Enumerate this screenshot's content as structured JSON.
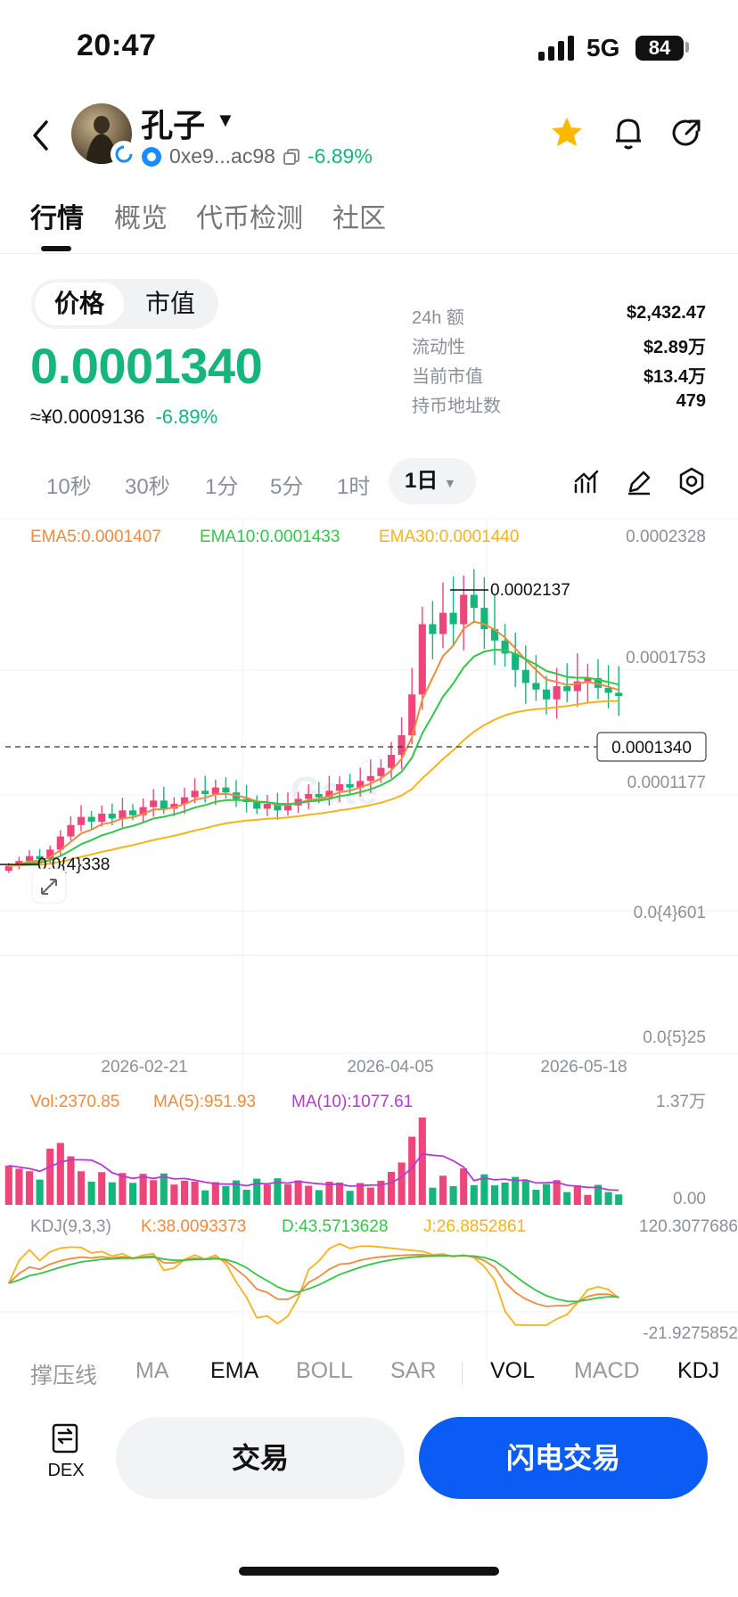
{
  "status": {
    "time": "20:47",
    "network": "5G",
    "battery": "84"
  },
  "token": {
    "name": "孔子",
    "address": "0xe9...ac98",
    "change": "-6.89%"
  },
  "tabs": [
    "行情",
    "概览",
    "代币检测",
    "社区"
  ],
  "price_toggle": [
    "价格",
    "市值"
  ],
  "price": {
    "main": "0.0001340",
    "cny": "≈¥0.0009136",
    "change": "-6.89%"
  },
  "stats": [
    {
      "label": "24h  额",
      "value": "$2,432.47"
    },
    {
      "label": "流动性",
      "value": "$2.89万"
    },
    {
      "label": "当前市值",
      "value": "$13.4万"
    },
    {
      "label": "持币地址数",
      "value": "479"
    }
  ],
  "intervals": [
    "10秒",
    "30秒",
    "1分",
    "5分",
    "1时"
  ],
  "selected_interval": "1日",
  "indicators": [
    "撑压线",
    "MA",
    "EMA",
    "BOLL",
    "SAR",
    "VOL",
    "MACD",
    "KDJ"
  ],
  "colors": {
    "up": "#f0457a",
    "down": "#16b57c",
    "ema5": "#f08a3c",
    "ema10": "#33c64a",
    "ema30": "#f5b31c",
    "brand": "#0a5cf5"
  },
  "chart_data": {
    "type": "candlestick",
    "price_panel": {
      "legend": {
        "ema5": "EMA5:0.0001407",
        "ema10": "EMA10:0.0001433",
        "ema30": "EMA30:0.0001440"
      },
      "y_ticks": [
        "0.0002328",
        "0.0001753",
        "0.0001177",
        "0.0{4}601",
        "0.0{5}25"
      ],
      "high_label": "0.0002137",
      "low_label": "0.0{4}338",
      "current_label": "0.0001340",
      "x_ticks": [
        "2026-02-21",
        "2026-04-05",
        "2026-05-18"
      ],
      "close_series": [
        3e-05,
        3.3e-05,
        3.6e-05,
        3.4e-05,
        4e-05,
        4.8e-05,
        5.5e-05,
        6e-05,
        5.7e-05,
        6.2e-05,
        5.9e-05,
        6.4e-05,
        6.1e-05,
        6.6e-05,
        7e-05,
        6.5e-05,
        6.8e-05,
        7.2e-05,
        7.6e-05,
        7.4e-05,
        7.8e-05,
        7.5e-05,
        7.1e-05,
        6.9e-05,
        6.5e-05,
        6.8e-05,
        6.4e-05,
        6.7e-05,
        7.1e-05,
        7.4e-05,
        7.2e-05,
        7.6e-05,
        8e-05,
        7.8e-05,
        8.2e-05,
        8.5e-05,
        9e-05,
        9.8e-05,
        0.00011,
        0.000135,
        0.000178,
        0.000172,
        0.000185,
        0.000178,
        0.000196,
        0.000188,
        0.000175,
        0.000168,
        0.00016,
        0.00015,
        0.000142,
        0.000138,
        0.000132,
        0.00014,
        0.000137,
        0.000143,
        0.000145,
        0.000139,
        0.000136,
        0.000134
      ]
    },
    "volume_panel": {
      "legend": {
        "vol": "Vol:2370.85",
        "ma5": "MA(5):951.93",
        "ma10": "MA(10):1077.61"
      },
      "y_ticks": [
        "1.37万",
        "0.00"
      ]
    },
    "kdj_panel": {
      "legend": {
        "name": "KDJ(9,3,3)",
        "k": "K:38.0093373",
        "d": "D:43.5713628",
        "j": "J:26.8852861"
      },
      "y_ticks": [
        "120.3077686",
        "-21.9275852"
      ]
    }
  }
}
